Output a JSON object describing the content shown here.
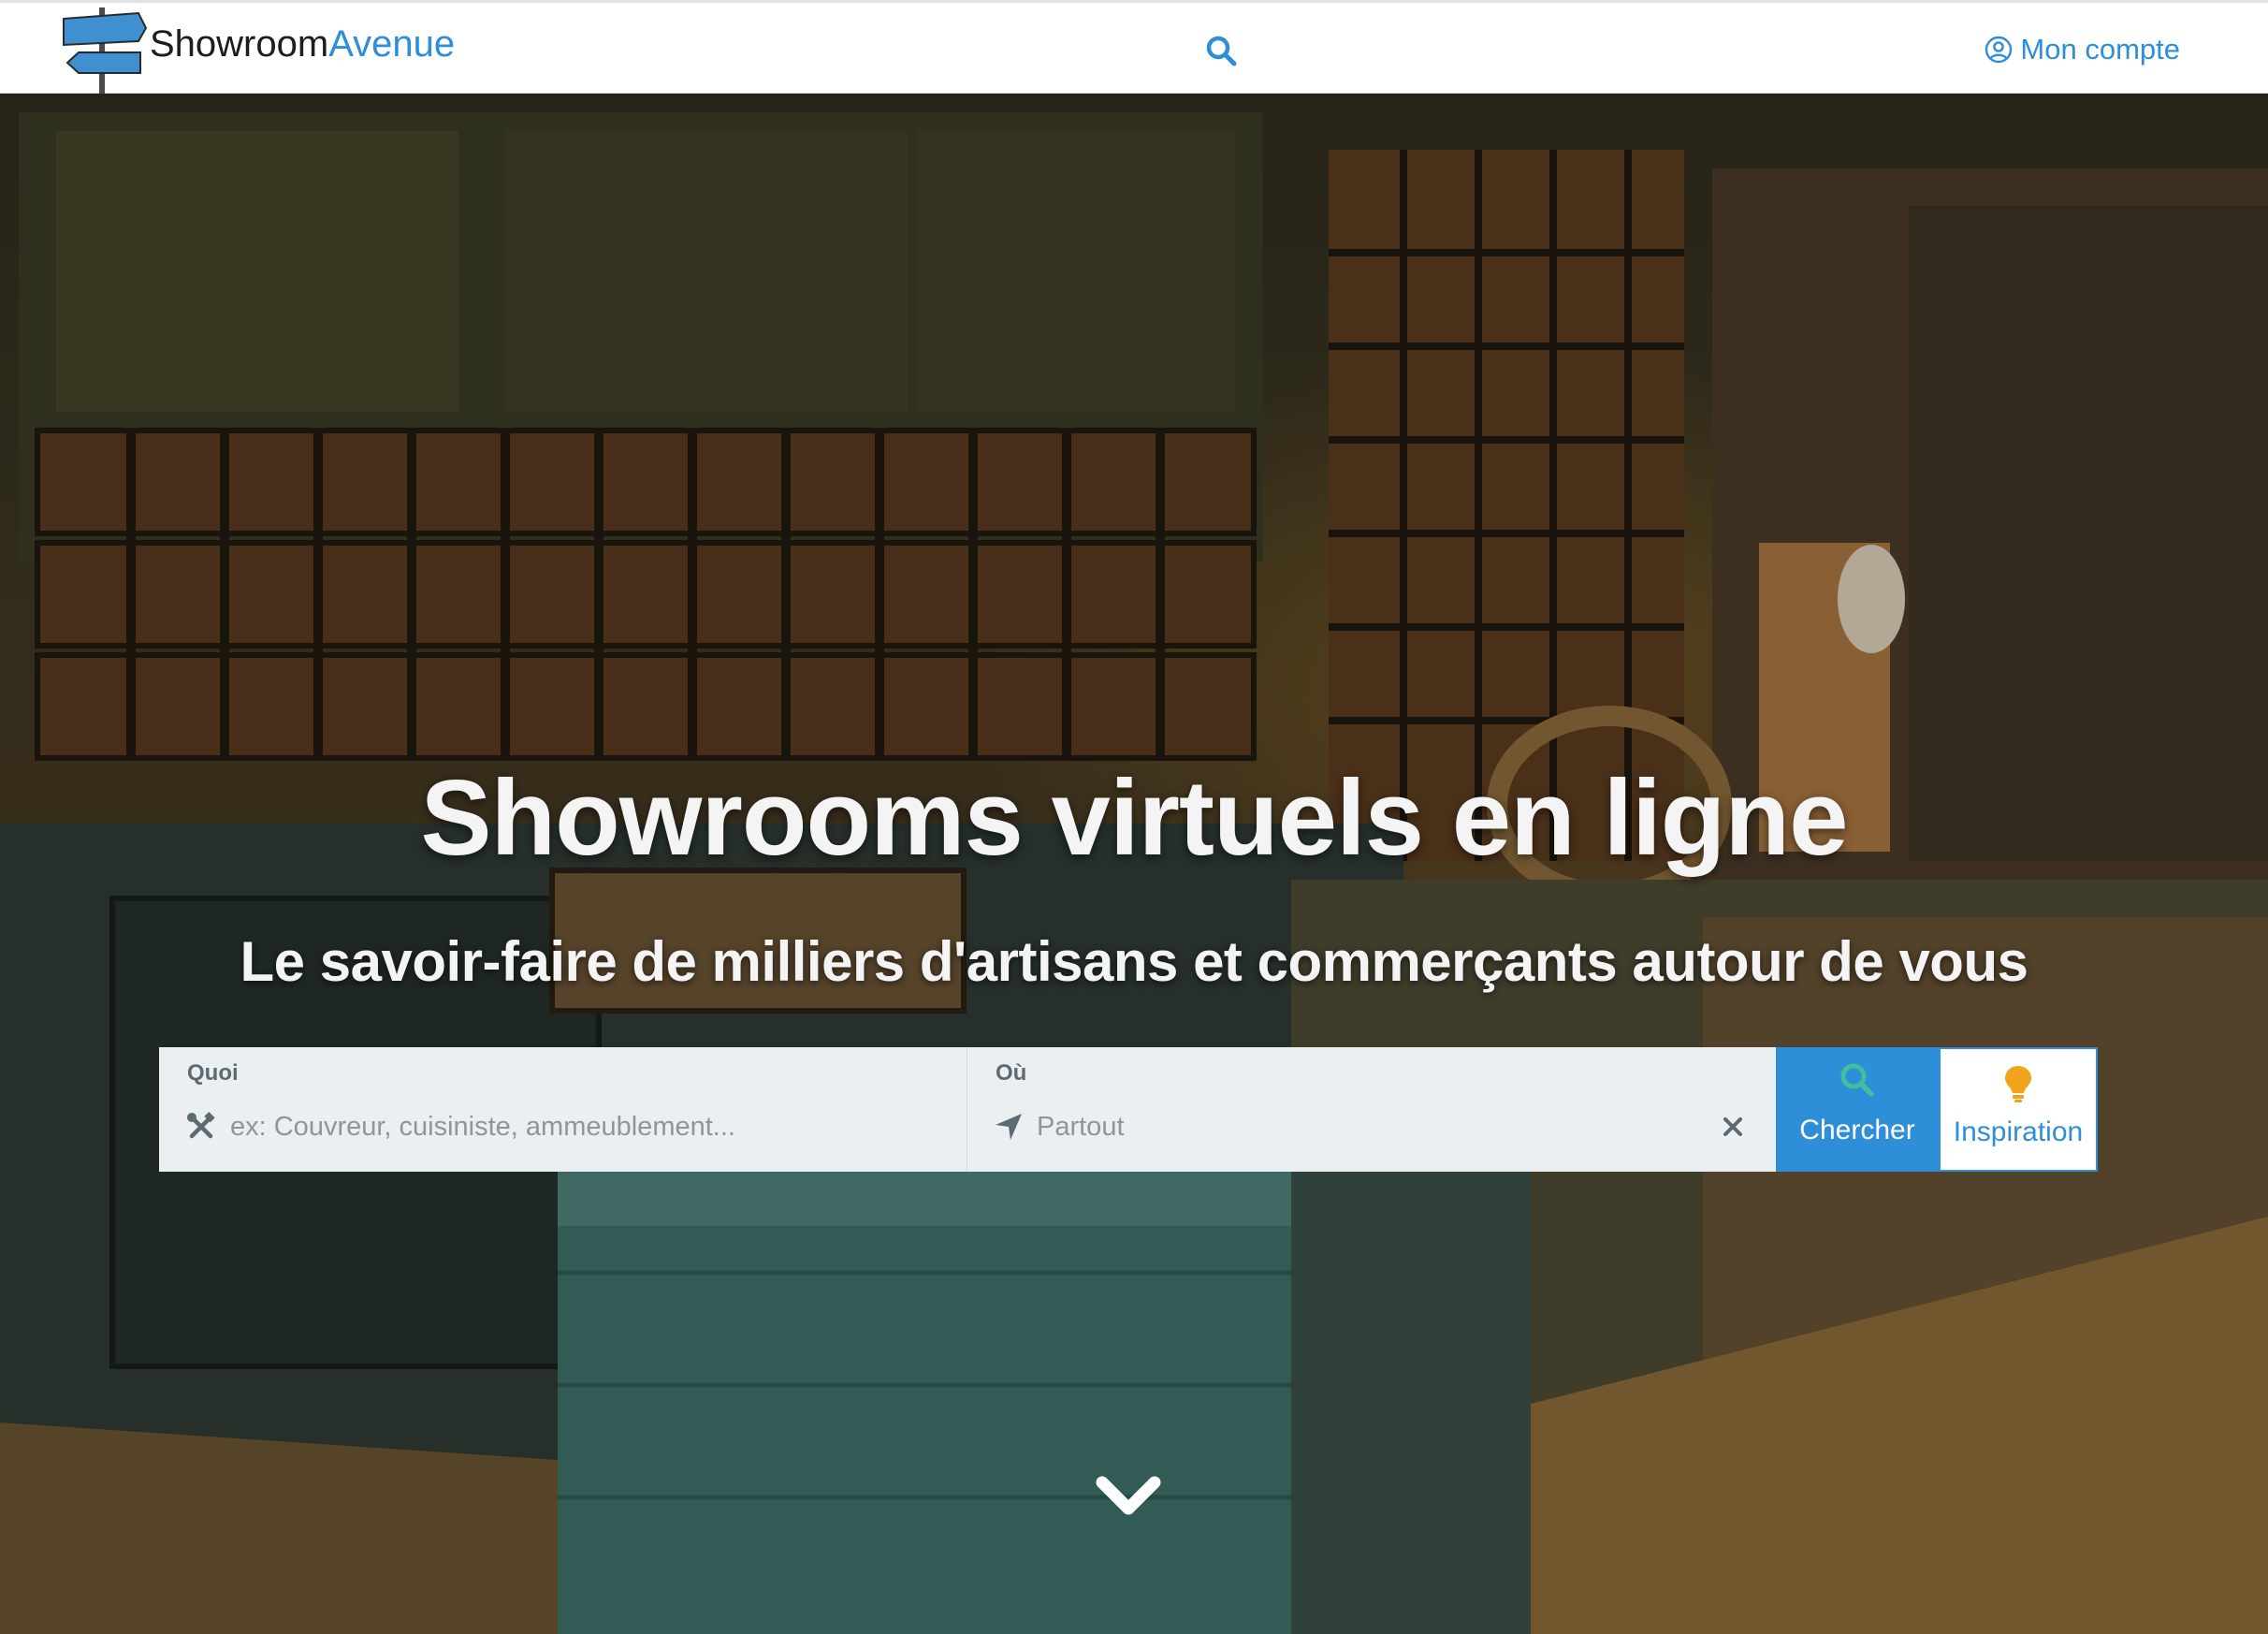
{
  "header": {
    "logo_alt": "Showroom Ave",
    "brand_part1": "Showroom",
    "brand_part2": "Avenue",
    "search_icon": "search-icon",
    "account_label": "Mon compte",
    "account_icon": "user-circle-icon"
  },
  "hero": {
    "title": "Showrooms virtuels en ligne",
    "subtitle": "Le savoir-faire de milliers d'artisans et commerçants autour de vous",
    "scroll_icon": "chevron-down-icon"
  },
  "search": {
    "what_label": "Quoi",
    "what_placeholder": "ex: Couvreur, cuisiniste, ammeublement...",
    "what_icon": "tools-icon",
    "where_label": "Où",
    "where_placeholder": "Partout",
    "where_icon": "location-arrow-icon",
    "clear_icon": "close-icon",
    "search_button": "Chercher",
    "inspiration_button": "Inspiration"
  },
  "colors": {
    "accent": "#2e8ed8",
    "search_icon_green": "#3fbf9b",
    "bulb_orange": "#f2a31b",
    "field_bg": "#eceff1"
  }
}
